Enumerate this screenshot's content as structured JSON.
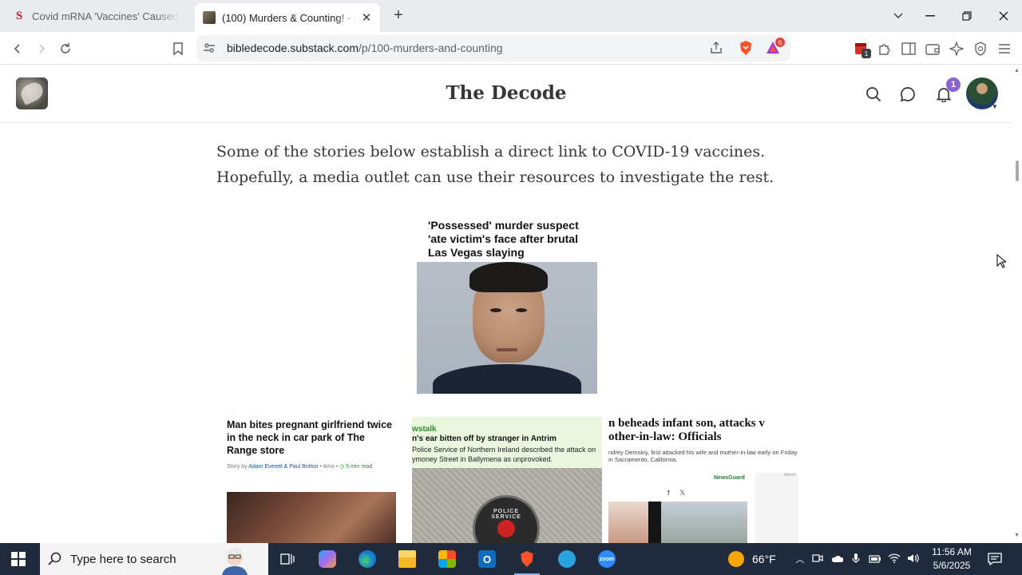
{
  "browser": {
    "tabs": [
      {
        "title": "Covid mRNA 'Vaccines' Caused 'Ala",
        "favicon": "S",
        "active": false
      },
      {
        "title": "(100) Murders & Counting! - by",
        "active": true
      }
    ],
    "url_domain": "bibledecode.substack.com",
    "url_path": "/p/100-murders-and-counting",
    "extensions_badge": "1",
    "brave_badge": "6"
  },
  "site": {
    "title": "The Decode",
    "notification_count": "1"
  },
  "article": {
    "paragraph": "Some of the stories below establish a direct link to COVID-19 vaccines. Hopefully, a media outlet can use their resources to investigate the rest.",
    "main_card": {
      "headline": "'Possessed' murder suspect 'ate victim's face after brutal Las Vegas slaying"
    },
    "cards": [
      {
        "headline": "Man bites pregnant girlfriend twice in the neck in car park of The Range store",
        "byline_prefix": "Story by",
        "byline_authors": "Adam Everett & Paul Britton",
        "byline_source": "• Amo •",
        "read_time": "5 min read"
      },
      {
        "source": "wstalk",
        "headline": "n's ear bitten off by stranger in Antrim",
        "dek": "Police Service of Northern Ireland described the attack on ymoney Street in Ballymena as unprovoked.",
        "badge_text": "POLICE SERVICE"
      },
      {
        "headline_line1": "n beheads infant son, attacks v",
        "headline_line2": "other-in-law: Officials",
        "dek_line1": "ndrey Demskiy, first attacked his wife and mother-in-law early on Friday",
        "dek_line2": "in Sacramento, California.",
        "share_f": "f",
        "share_x": "𝕏",
        "newsguard": "NewsGuard",
        "ad_label": "Advert"
      }
    ]
  },
  "taskbar": {
    "search_placeholder": "Type here to search",
    "weather": "66°F",
    "time": "11:56 AM",
    "date": "5/6/2025"
  },
  "colors": {
    "accent_purple": "#8a63d2",
    "taskbar_bg": "#1f2a3c",
    "tabstrip_bg": "#e9ebef"
  }
}
